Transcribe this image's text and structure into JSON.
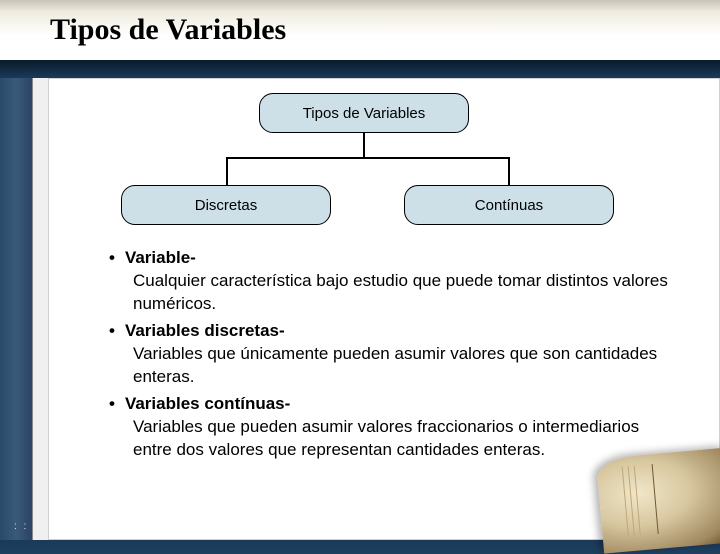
{
  "title": "Tipos de Variables",
  "chart": {
    "root": "Tipos de Variables",
    "left": "Discretas",
    "right": "Contínuas"
  },
  "bullets": [
    {
      "term": "Variable-",
      "desc": "Cualquier característica bajo estudio que puede tomar distintos valores numéricos."
    },
    {
      "term": "Variables discretas-",
      "desc": "Variables que únicamente pueden asumir valores que son cantidades enteras."
    },
    {
      "term": "Variables contínuas-",
      "desc": "Variables que pueden asumir valores fraccionarios o intermediarios entre dos valores que representan cantidades enteras."
    }
  ]
}
